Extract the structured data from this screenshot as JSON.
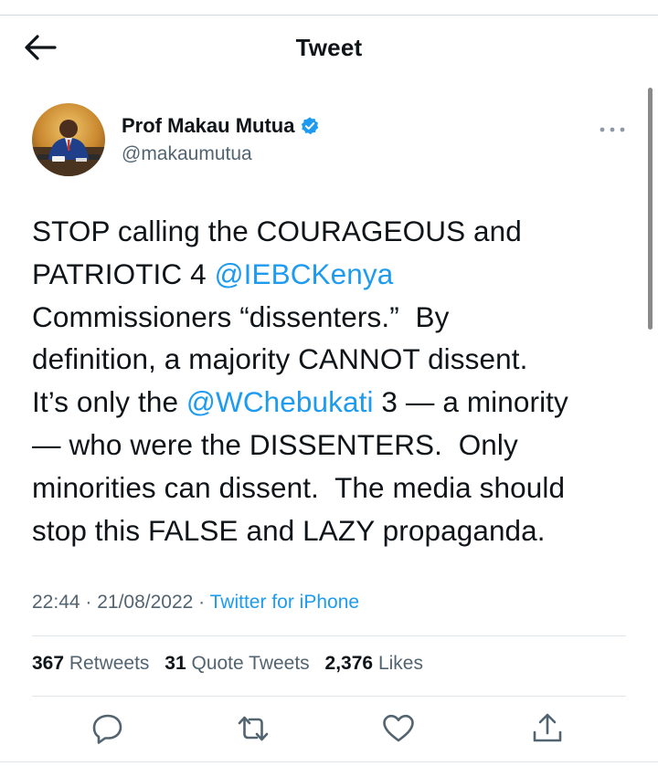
{
  "header": {
    "title": "Tweet",
    "back_icon": "arrow-left-icon"
  },
  "author": {
    "name": "Prof Makau Mutua",
    "handle": "@makaumutua",
    "verified_icon": "verified-badge-icon",
    "more_icon": "more-horizontal-icon"
  },
  "tweet": {
    "lines": [
      [
        {
          "t": "STOP calling the COURAGEOUS and"
        }
      ],
      [
        {
          "t": "PATRIOTIC 4 "
        },
        {
          "t": "@IEBCKenya",
          "mention": true
        }
      ],
      [
        {
          "t": "Commissioners “dissenters.”  By"
        }
      ],
      [
        {
          "t": "definition, a majority CANNOT dissent."
        }
      ],
      [
        {
          "t": "It’s only the "
        },
        {
          "t": "@WChebukati",
          "mention": true
        },
        {
          "t": " 3 — a minority"
        }
      ],
      [
        {
          "t": "— who were the DISSENTERS.  Only"
        }
      ],
      [
        {
          "t": "minorities can dissent.  The media should"
        }
      ],
      [
        {
          "t": "stop this FALSE and LAZY propaganda."
        }
      ]
    ]
  },
  "meta": {
    "time": "22:44",
    "separator": " · ",
    "date": "21/08/2022",
    "source": "Twitter for iPhone"
  },
  "stats": {
    "retweets_count": "367",
    "retweets_label": "Retweets",
    "quotes_count": "31",
    "quotes_label": "Quote Tweets",
    "likes_count": "2,376",
    "likes_label": "Likes"
  },
  "actions": {
    "icons": [
      "reply-icon",
      "retweet-icon",
      "like-icon",
      "share-icon"
    ]
  },
  "colors": {
    "accent": "#1d9bf0",
    "text": "#0f1419",
    "secondary": "#536471"
  }
}
